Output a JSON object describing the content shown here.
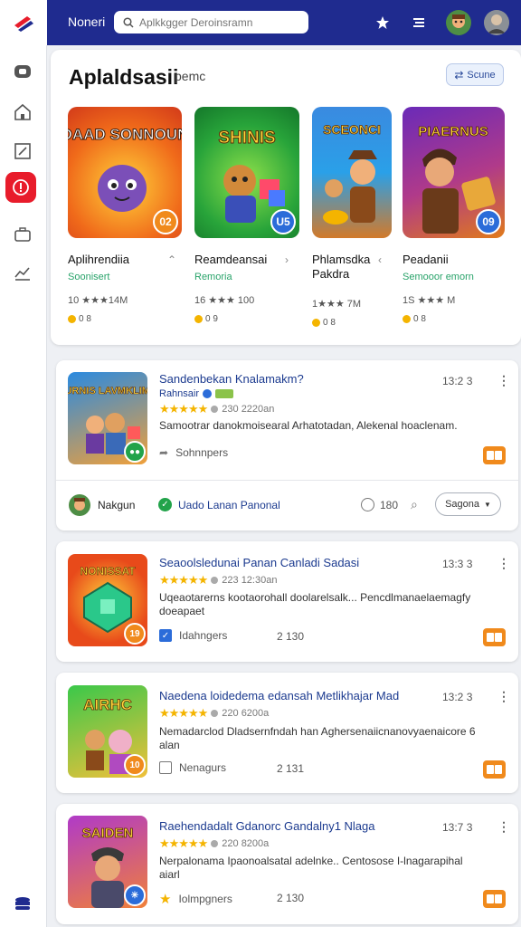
{
  "topbar": {
    "title": "Noneri",
    "search_placeholder": "Aplkkgger Deroinsramn"
  },
  "featured": {
    "title": "Aplaldsasii",
    "subtitle": "pemc",
    "scene_button": "Scune",
    "cards": [
      {
        "art_text": "DAAD SONNOUN",
        "name": "Aplihrendiia",
        "category": "Soonisert",
        "rating_text": "10 ★★★14M",
        "badge": "02",
        "badge_color": "#f08a1c",
        "coin": "0 8"
      },
      {
        "art_text": "SHINIS",
        "name": "Reamdeansai",
        "category": "Remoria",
        "rating_text": "16 ★★★ 100",
        "badge": "U5",
        "badge_color": "#2b6cd9",
        "coin": "0 9"
      },
      {
        "art_text": "SCEONCI",
        "name": "Phlamsdka Pakdra",
        "category": "",
        "rating_text": "1★★★ 7M",
        "badge": "",
        "badge_color": "",
        "coin": "0 8"
      },
      {
        "art_text": "PIAERNUS",
        "name": "Peadanii",
        "category": "Semooor emorn",
        "rating_text": "1S ★★★ M",
        "badge": "09",
        "badge_color": "#2b6cd9",
        "coin": "0 8"
      }
    ]
  },
  "items": [
    {
      "art_text": "SURNIS LAVMKLIMA",
      "title": "Sandenbekan Knalamakm?",
      "time": "13:2 3",
      "stars": "★★★★★",
      "rating_meta": "230 2220an",
      "tags": [
        "Rahnsair"
      ],
      "description": "Samootrar danokmoisearal Arhatotadan, Alekenal hoaclenam.",
      "footer_label": "Sohnnpers",
      "footer_num": "",
      "badge": "",
      "badge_color": "#22a34a",
      "author": "Nakgun",
      "author_status": "Uado Lanan Panonal",
      "count": "180",
      "dropdown": "Sagona"
    },
    {
      "art_text": "NONISSAT",
      "title": "Seaoolsledunai Panan Canladi Sadasi",
      "time": "13:3 3",
      "stars": "★★★★★",
      "rating_meta": "223 12:30an",
      "description": "Uqeaotarerns kootaorohall doolarelsalk... Pencdlmanaelaemagfy doeapaet",
      "footer_label": "Idahngers",
      "footer_num": "2 130",
      "badge": "19",
      "badge_color": "#f08a1c"
    },
    {
      "art_text": "AIRHC",
      "title": "Naedena loidedema edansah Metlikhajar Mad",
      "time": "13:2 3",
      "stars": "★★★★★",
      "rating_meta": "220 6200a",
      "description": "Nemadarclod Dladsernfndah han Aghersenaiicnanovyaenaicore 6 alan",
      "footer_label": "Nenagurs",
      "footer_num": "2 131",
      "badge": "10",
      "badge_color": "#f08a1c"
    },
    {
      "art_text": "SAIDEN",
      "title": "Raehendadalt Gdanorc Gandalny1 Nlaga",
      "time": "13:7 3",
      "stars": "★★★★★",
      "rating_meta": "220 8200a",
      "description": "Nerpalonama Ipaonoalsatal adelnke.. Centosose I-lnagarapihal aiarl",
      "footer_label": "Iolmpgners",
      "footer_num": "2 130",
      "badge": "✳",
      "badge_color": "#2b6cd9"
    }
  ],
  "colors": {
    "topbar": "#1f2b8f",
    "accent_red": "#e81c2b",
    "link_blue": "#1b3a8f",
    "star": "#f4b400",
    "orange": "#f08a1c",
    "green": "#29a36a"
  }
}
